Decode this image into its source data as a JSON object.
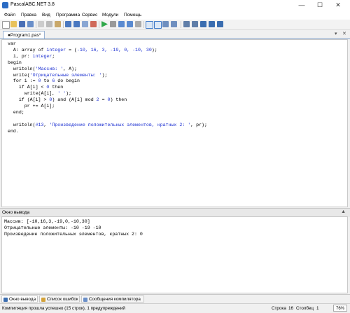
{
  "window": {
    "title": "PascalABC.NET 3.8"
  },
  "menu": [
    "Файл",
    "Правка",
    "Вид",
    "Программа",
    "Сервис",
    "Модули",
    "Помощь"
  ],
  "editor_tab": {
    "label": "●Program1.pas*"
  },
  "code": {
    "l1": "var",
    "l2_a": "  A: array of ",
    "l2_type": "integer",
    "l2_b": " = (",
    "l2_vals": "-10, 16, 3, -19, 0, -10, 30",
    "l2_c": ");",
    "l3_a": "  i, pr: ",
    "l3_type": "integer",
    "l3_b": ";",
    "l4": "begin",
    "l5_a": "  writeln(",
    "l5_str": "'Массив: '",
    "l5_b": ", A);",
    "l6_a": "  write(",
    "l6_str": "'Отрицательные элементы: '",
    "l6_b": ");",
    "l7_a": "  for i := ",
    "l7_n1": "0",
    "l7_b": " to ",
    "l7_n2": "6",
    "l7_c": " do begin",
    "l8_a": "    if A[i] < ",
    "l8_n": "0",
    "l8_b": " then",
    "l9_a": "      write(A[i], ",
    "l9_str": "' '",
    "l9_b": ");",
    "l10_a": "    if (A[i] > ",
    "l10_n1": "0",
    "l10_b": ") and (A[i] mod ",
    "l10_n2": "2",
    "l10_c": " = ",
    "l10_n3": "0",
    "l10_d": ") then",
    "l11_a": "      pr += A[i];",
    "l12": "  end;",
    "l13": "",
    "l14_a": "  writeln(",
    "l14_n": "#13",
    "l14_b": ", ",
    "l14_str": "'Произведение положительных элементов, кратных 2: '",
    "l14_c": ", pr);",
    "l15": "end."
  },
  "output_panel": {
    "title": "Окно вывода",
    "lines": [
      "Массив: [-10,16,3,-19,0,-10,30]",
      "Отрицательные элементы: -10 -19 -10",
      "Произведение положительных элементов, кратных 2: 0"
    ]
  },
  "bottom_tabs": [
    "Окно вывода",
    "Список ошибок",
    "Сообщения компилятора"
  ],
  "status": {
    "message": "Компиляция прошла успешно (15 строк), 1 предупреждений",
    "line_label": "Строка",
    "line_value": "16",
    "col_label": "Столбец",
    "col_value": "1",
    "zoom": "76%"
  },
  "colors": {
    "keyword_blue": "#1a2ed1",
    "tab_border": "#7fa0c8"
  }
}
